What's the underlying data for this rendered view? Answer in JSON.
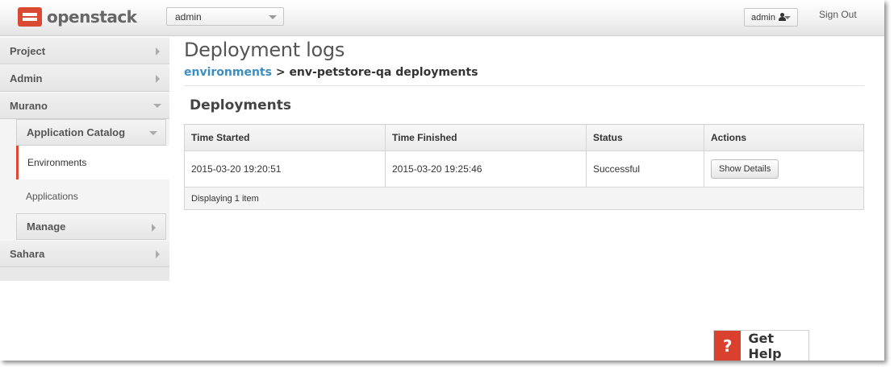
{
  "header": {
    "brand": "openstack",
    "project_select": "admin",
    "user_menu": "admin",
    "sign_out": "Sign Out"
  },
  "sidebar": {
    "project": "Project",
    "admin": "Admin",
    "murano": "Murano",
    "application_catalog": "Application Catalog",
    "environments": "Environments",
    "applications": "Applications",
    "manage": "Manage",
    "sahara": "Sahara"
  },
  "page": {
    "title": "Deployment logs",
    "breadcrumb_link": "environments",
    "breadcrumb_separator": ">",
    "breadcrumb_current": "env-petstore-qa deployments",
    "section_title": "Deployments"
  },
  "table": {
    "columns": [
      "Time Started",
      "Time Finished",
      "Status",
      "Actions"
    ],
    "rows": [
      {
        "time_started": "2015-03-20 19:20:51",
        "time_finished": "2015-03-20 19:25:46",
        "status": "Successful",
        "action": "Show Details"
      }
    ],
    "footer": "Displaying 1 item"
  },
  "help": {
    "icon": "?",
    "label": "Get Help"
  },
  "colors": {
    "brand_red": "#da4a32",
    "link_blue": "#3b8ec2"
  }
}
